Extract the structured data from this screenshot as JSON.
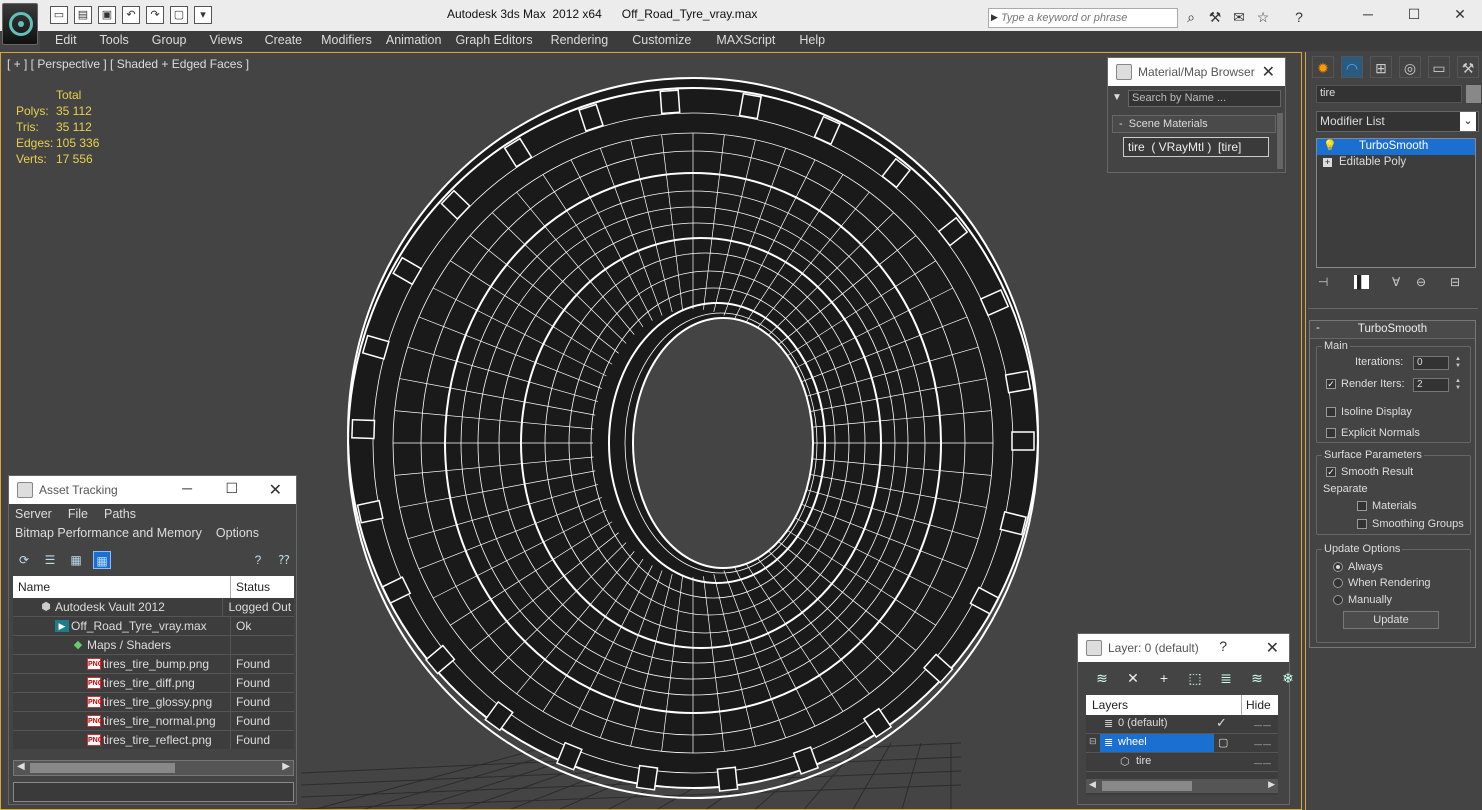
{
  "window": {
    "title": "Autodesk 3ds Max  2012 x64      Off_Road_Tyre_vray.max",
    "search_placeholder": "Type a keyword or phrase"
  },
  "menu": [
    "Edit",
    "Tools",
    "Group",
    "Views",
    "Create",
    "Modifiers",
    "Animation",
    "Graph Editors",
    "Rendering",
    "Customize",
    "MAXScript",
    "Help"
  ],
  "viewport": {
    "label": "[ + ] [ Perspective ] [ Shaded + Edged Faces ]",
    "stats_header": "Total",
    "stats": [
      {
        "k": "Polys:",
        "v": "35 112"
      },
      {
        "k": "Tris:",
        "v": "35 112"
      },
      {
        "k": "Edges:",
        "v": "105 336"
      },
      {
        "k": "Verts:",
        "v": "17 556"
      }
    ]
  },
  "material_browser": {
    "title": "Material/Map Browser",
    "search_placeholder": "Search by Name ...",
    "group": "Scene Materials",
    "group_toggle": "-",
    "item": "tire  ( VRayMtl )  [tire]"
  },
  "asset_tracking": {
    "title": "Asset Tracking",
    "menu1": [
      "Server",
      "File",
      "Paths"
    ],
    "menu2": [
      "Bitmap Performance and Memory",
      "Options"
    ],
    "columns": [
      "Name",
      "Status"
    ],
    "rows": [
      {
        "name": "Autodesk Vault 2012",
        "status": "Logged Out",
        "icon": "vault-icon"
      },
      {
        "name": "Off_Road_Tyre_vray.max",
        "status": "Ok",
        "icon": "max-file-icon"
      },
      {
        "name": "Maps / Shaders",
        "status": "",
        "icon": "maps-icon"
      },
      {
        "name": "tires_tire_bump.png",
        "status": "Found",
        "icon": "png-icon"
      },
      {
        "name": "tires_tire_diff.png",
        "status": "Found",
        "icon": "png-icon"
      },
      {
        "name": "tires_tire_glossy.png",
        "status": "Found",
        "icon": "png-icon"
      },
      {
        "name": "tires_tire_normal.png",
        "status": "Found",
        "icon": "png-icon"
      },
      {
        "name": "tires_tire_reflect.png",
        "status": "Found",
        "icon": "png-icon"
      }
    ]
  },
  "layer_panel": {
    "title": "Layer: 0 (default)",
    "help": "?",
    "columns": [
      "Layers",
      "Hide"
    ],
    "rows": [
      {
        "name": "0 (default)",
        "check": "✓"
      },
      {
        "name": "wheel",
        "check": ""
      },
      {
        "name": "tire",
        "check": ""
      }
    ]
  },
  "command_panel": {
    "object_name": "tire",
    "modifier_list": "Modifier List",
    "stack": [
      {
        "name": "TurboSmooth",
        "selected": true
      },
      {
        "name": "Editable Poly",
        "selected": false
      }
    ],
    "turbosmooth": {
      "title": "TurboSmooth",
      "main_group": "Main",
      "iterations_label": "Iterations:",
      "iterations_value": "0",
      "render_iters_label": "Render Iters:",
      "render_iters_value": "2",
      "isoline_label": "Isoline Display",
      "explicit_label": "Explicit Normals",
      "surface_group": "Surface Parameters",
      "smooth_result_label": "Smooth Result",
      "separate_label": "Separate",
      "materials_label": "Materials",
      "smoothing_groups_label": "Smoothing Groups",
      "update_group": "Update Options",
      "always_label": "Always",
      "when_rendering_label": "When Rendering",
      "manually_label": "Manually",
      "update_button": "Update"
    }
  },
  "colors": {
    "viewport_border": "#d8a53a",
    "stats_text": "#e8d04c",
    "selection": "#1a6fd1"
  }
}
